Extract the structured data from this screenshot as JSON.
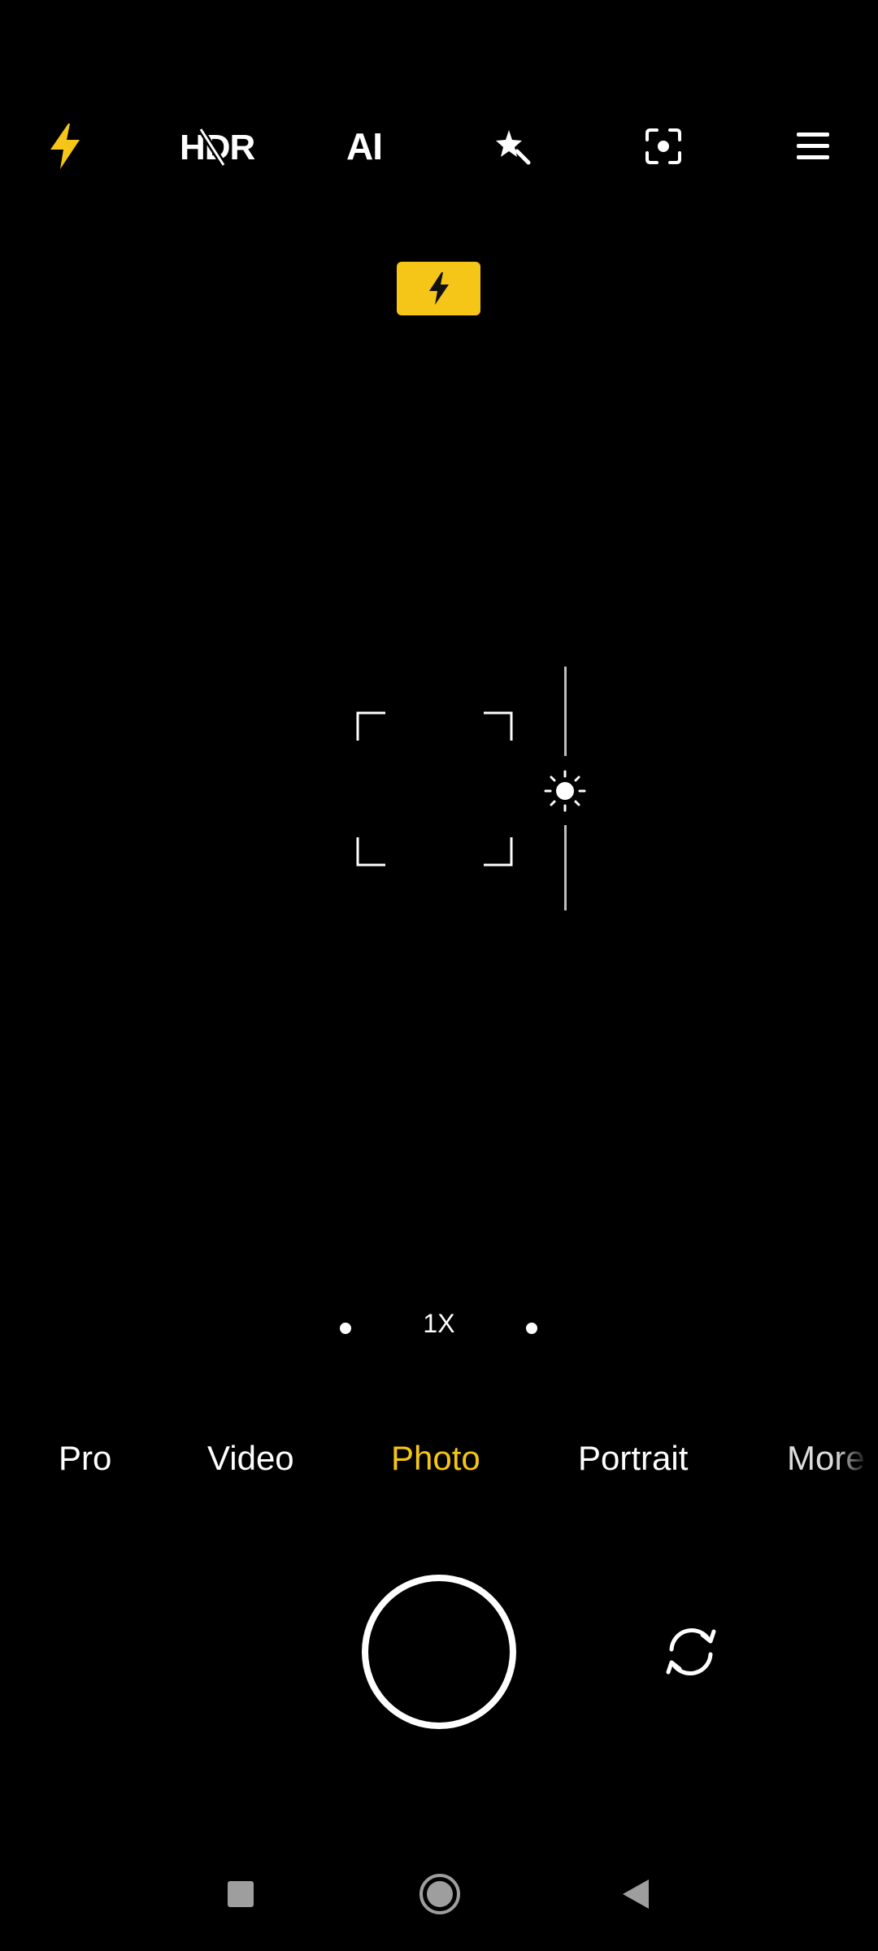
{
  "top_bar": {
    "flash": {
      "icon": "flash-icon",
      "color": "#f5c518"
    },
    "hdr": {
      "label": "HDR",
      "icon": "hdr-off-icon"
    },
    "ai": {
      "label": "AI"
    },
    "beauty": {
      "icon": "magic-star-icon"
    },
    "focus_mode": {
      "icon": "focus-target-icon"
    },
    "menu": {
      "icon": "menu-icon"
    }
  },
  "flash_indicator": {
    "icon": "flash-icon",
    "color": "#f5c518"
  },
  "viewfinder": {
    "focus_frame": true,
    "exposure": {
      "icon": "sun-icon"
    }
  },
  "zoom": {
    "label": "1X"
  },
  "modes": {
    "items": [
      "Pro",
      "Video",
      "Photo",
      "Portrait",
      "More"
    ],
    "active": "Photo",
    "active_color": "#f5c518"
  },
  "controls": {
    "shutter": {
      "icon": "shutter-button"
    },
    "switch_camera": {
      "icon": "switch-camera-icon"
    }
  },
  "nav_bar": {
    "recents": {
      "icon": "square-icon"
    },
    "home": {
      "icon": "home-circle-icon"
    },
    "back": {
      "icon": "back-triangle-icon"
    }
  }
}
